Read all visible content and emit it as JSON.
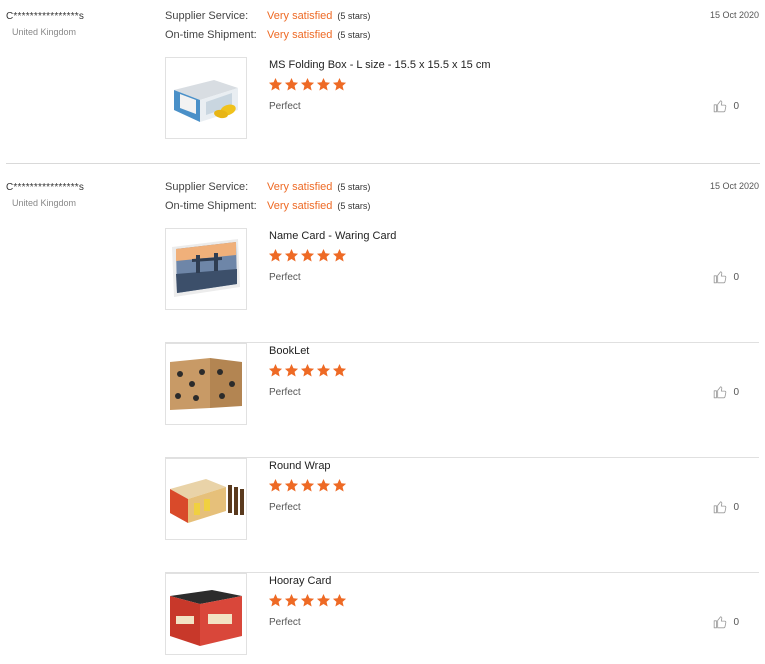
{
  "colors": {
    "accent": "#ee6a25",
    "divider": "#d9d9d9",
    "star": "#ee6a25"
  },
  "reviews": [
    {
      "buyer": "C****************s",
      "country": "United Kingdom",
      "date": "15 Oct 2020",
      "supplier_label": "Supplier Service:",
      "supplier_value": "Very satisfied",
      "supplier_stars": "(5 stars)",
      "shipment_label": "On-time Shipment:",
      "shipment_value": "Very satisfied",
      "shipment_stars": "(5 stars)",
      "products": [
        {
          "title": "MS Folding Box - L size - 15.5 x 15.5 x 15 cm",
          "rating": 5,
          "feedback": "Perfect",
          "likes": "0",
          "image": "folding-box-image"
        }
      ]
    },
    {
      "buyer": "C****************s",
      "country": "United Kingdom",
      "date": "15 Oct 2020",
      "supplier_label": "Supplier Service:",
      "supplier_value": "Very satisfied",
      "supplier_stars": "(5 stars)",
      "shipment_label": "On-time Shipment:",
      "shipment_value": "Very satisfied",
      "shipment_stars": "(5 stars)",
      "products": [
        {
          "title": "Name Card - Waring Card",
          "rating": 5,
          "feedback": "Perfect",
          "likes": "0",
          "image": "name-card-image"
        },
        {
          "title": "BookLet",
          "rating": 5,
          "feedback": "Perfect",
          "likes": "0",
          "image": "booklet-box-image"
        },
        {
          "title": "Round Wrap",
          "rating": 5,
          "feedback": "Perfect",
          "likes": "0",
          "image": "round-wrap-image"
        },
        {
          "title": "Hooray Card",
          "rating": 5,
          "feedback": "Perfect",
          "likes": "0",
          "image": "hooray-card-image"
        }
      ]
    }
  ]
}
